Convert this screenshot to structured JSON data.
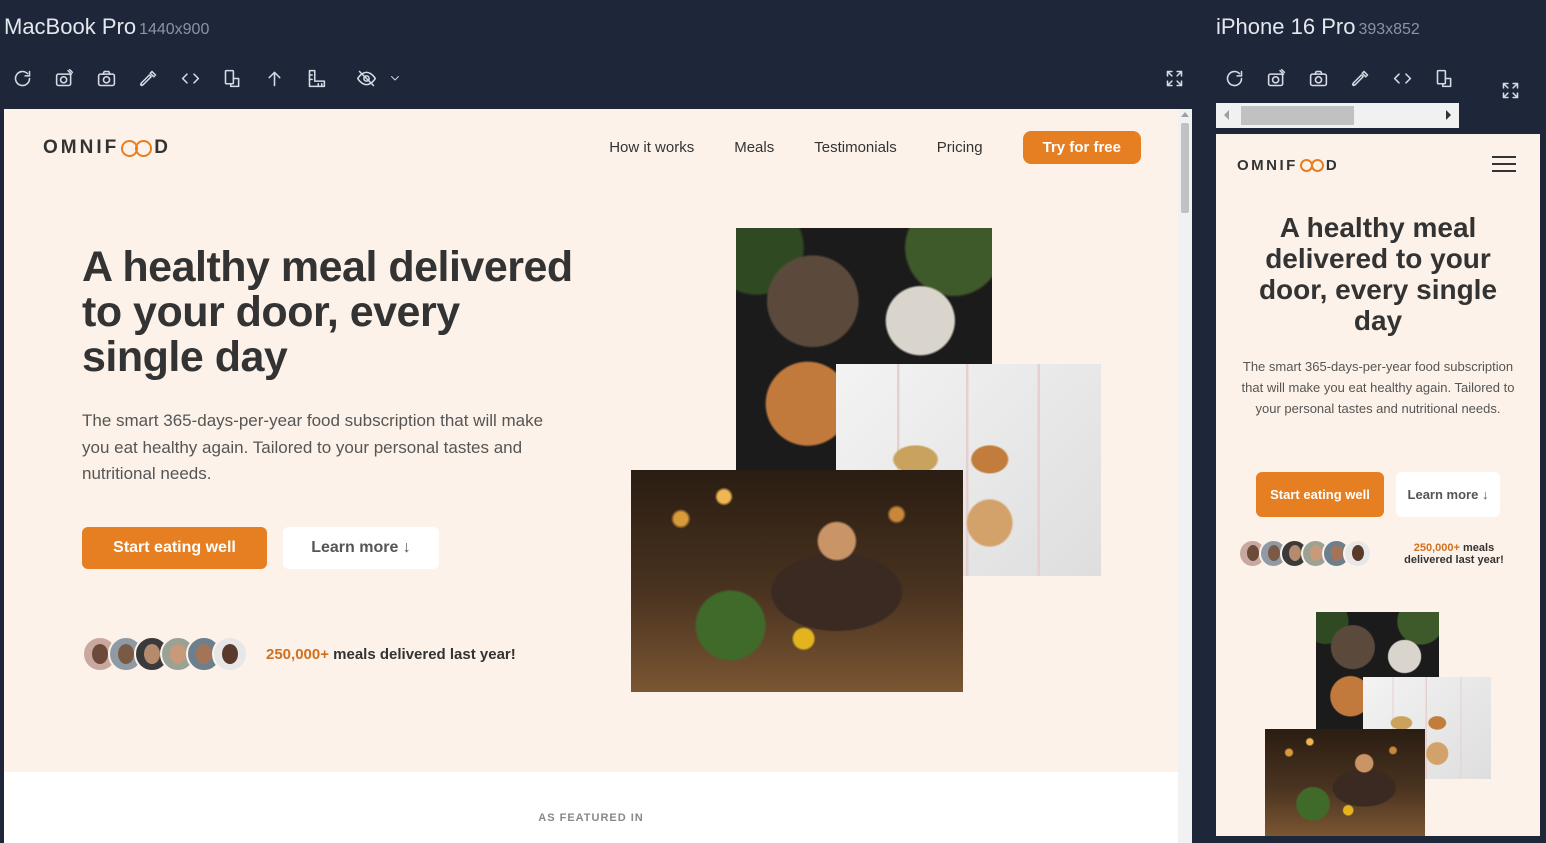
{
  "devices": {
    "desktop": {
      "name": "MacBook Pro",
      "size": "1440x900"
    },
    "mobile": {
      "name": "iPhone 16 Pro",
      "size": "393x852"
    }
  },
  "toolbar": {
    "icons": [
      "refresh-icon",
      "screenshot-edit-icon",
      "camera-icon",
      "color-picker-icon",
      "code-icon",
      "rotate-device-icon",
      "scroll-top-icon",
      "ruler-icon",
      "hide-icon",
      "chevron-down-icon",
      "fullscreen-icon"
    ]
  },
  "site": {
    "logo": {
      "before": "OMNIF",
      "after": "D"
    },
    "nav": {
      "how_it_works": "How it works",
      "meals": "Meals",
      "testimonials": "Testimonials",
      "pricing": "Pricing",
      "cta": "Try for free"
    },
    "hero": {
      "title": "A healthy meal delivered to your door, every single day",
      "description": "The smart 365-days-per-year food subscription that will make you eat healthy again. Tailored to your personal tastes and nutritional needs.",
      "primary_button": "Start eating well",
      "secondary_button": "Learn more ↓",
      "delivered_count": "250,000+",
      "delivered_text": "meals delivered last year!"
    },
    "featured": {
      "heading": "AS FEATURED IN"
    }
  },
  "colors": {
    "background": "#fdf2e9",
    "accent": "#e67e22",
    "text": "#333333",
    "app_bg": "#1e2639"
  }
}
